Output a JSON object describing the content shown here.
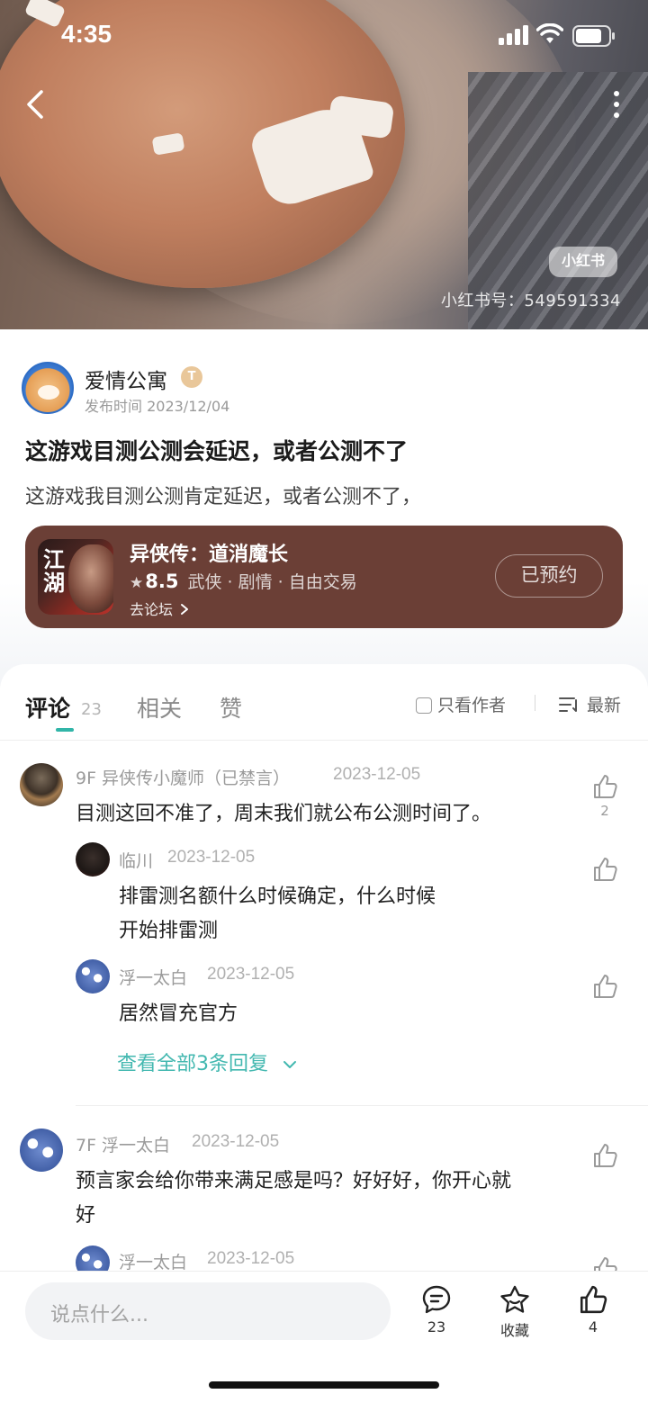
{
  "status": {
    "time": "4:35"
  },
  "hero": {
    "badge": "小红书",
    "watermark": "小红书号：549591334"
  },
  "post": {
    "author": "爱情公寓",
    "author_badge": "T",
    "publish_time": "发布时间 2023/12/04",
    "title": "这游戏目测公测会延迟，或者公测不了",
    "body": "这游戏我目测公测肯定延迟，或者公测不了，"
  },
  "game": {
    "icon_text": "江湖",
    "name": "异侠传：道消魔长",
    "score": "8.5",
    "tags": "武侠 · 剧情 · 自由交易",
    "forum_link": "去论坛",
    "reserve_label": "已预约"
  },
  "tabs": {
    "comments": "评论",
    "comments_count": "23",
    "related": "相关",
    "likes": "赞",
    "only_author": "只看作者",
    "sort": "最新"
  },
  "comments": [
    {
      "floor": "9F 异侠传小魔师（已禁言）",
      "date": "2023-12-05",
      "text": "目测这回不准了，周末我们就公布公测时间了。",
      "like_count": "2",
      "replies": [
        {
          "name": "临川",
          "date": "2023-12-05",
          "text_line1": "排雷测名额什么时候确定，什么时候",
          "text_line2": "开始排雷测"
        },
        {
          "name": "浮一太白",
          "date": "2023-12-05",
          "text_line1": "居然冒充官方"
        }
      ],
      "expand": "查看全部3条回复"
    },
    {
      "floor": "7F 浮一太白",
      "date": "2023-12-05",
      "text_line1": "预言家会给你带来满足感是吗？好好好，你开心就",
      "text_line2": "好",
      "replies": [
        {
          "name": "浮一太白",
          "date": "2023-12-05"
        }
      ]
    }
  ],
  "bottom": {
    "placeholder": "说点什么...",
    "comment_count": "23",
    "favorite_label": "收藏",
    "like_count": "4"
  },
  "colors": {
    "accent": "#31b5a8",
    "card_bg": "#6b3f36"
  }
}
